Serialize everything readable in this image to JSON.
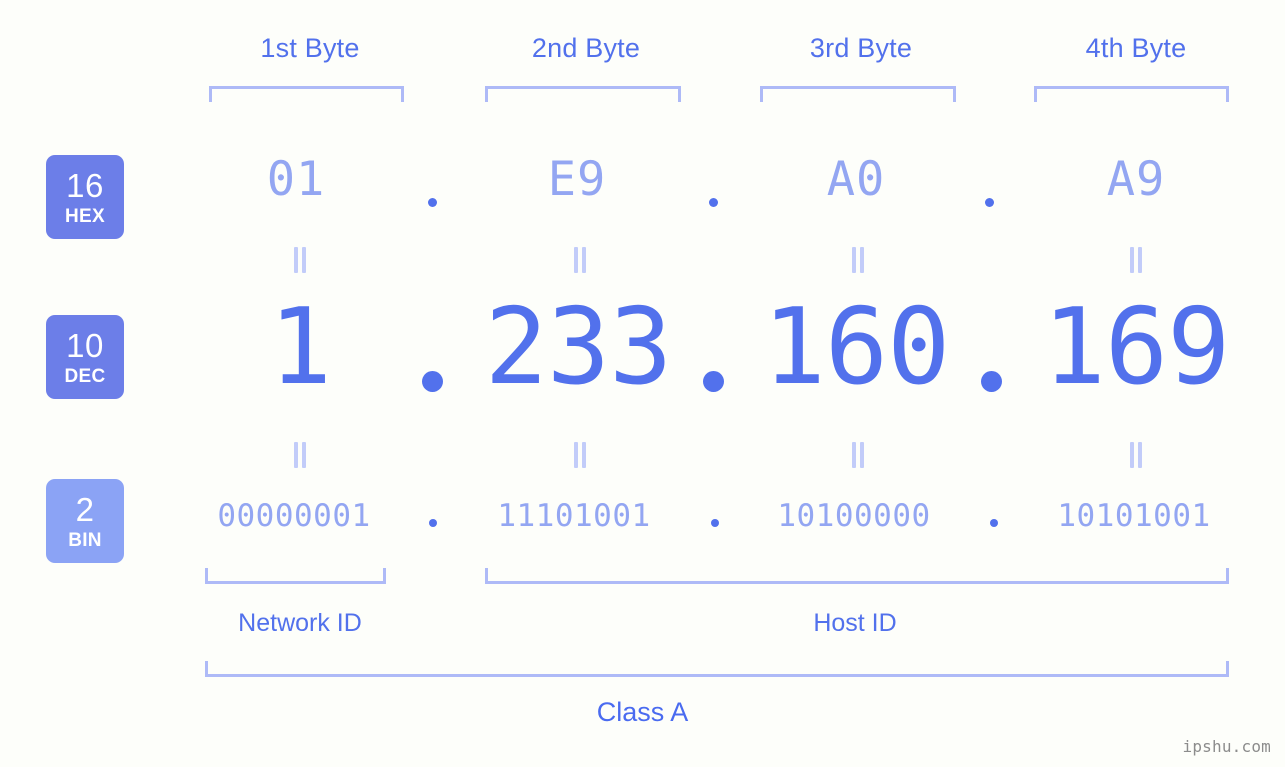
{
  "watermark": "ipshu.com",
  "colors": {
    "background": "#fdfefa",
    "accent_strong": "#5271ec",
    "accent_mid": "#6c7ee8",
    "accent_light": "#93a6f2",
    "bracket": "#aebaf7",
    "equals": "#c2ccf9",
    "badge_bin": "#8ba3f5",
    "class_text": "#4a6bf0",
    "watermark_text": "#8c8c8c"
  },
  "byte_headers": [
    {
      "label": "1st Byte"
    },
    {
      "label": "2nd Byte"
    },
    {
      "label": "3rd Byte"
    },
    {
      "label": "4th Byte"
    }
  ],
  "bases": [
    {
      "num": "16",
      "name": "HEX"
    },
    {
      "num": "10",
      "name": "DEC"
    },
    {
      "num": "2",
      "name": "BIN"
    }
  ],
  "separator": ".",
  "equals_symbol": "=",
  "rows": {
    "hex": {
      "octets": [
        "01",
        "E9",
        "A0",
        "A9"
      ]
    },
    "dec": {
      "octets": [
        "1",
        "233",
        "160",
        "169"
      ]
    },
    "bin": {
      "octets": [
        "00000001",
        "11101001",
        "10100000",
        "10101001"
      ]
    }
  },
  "segments": [
    {
      "label": "Network ID"
    },
    {
      "label": "Host ID"
    }
  ],
  "class": {
    "label": "Class A"
  },
  "chart_data": {
    "type": "diagram",
    "title": "IP address byte breakdown",
    "ip_address": "1.233.160.169",
    "hex_address": "01.E9.A0.A9",
    "binary_address": "00000001.11101001.10100000.10101001",
    "address_class": "Class A",
    "network_id_bytes": [
      1
    ],
    "host_id_bytes": [
      2,
      3,
      4
    ],
    "bytes": [
      {
        "index": 1,
        "header": "1st Byte",
        "hex": "01",
        "dec": "1",
        "bin": "00000001",
        "part": "Network ID"
      },
      {
        "index": 2,
        "header": "2nd Byte",
        "hex": "E9",
        "dec": "233",
        "bin": "11101001",
        "part": "Host ID"
      },
      {
        "index": 3,
        "header": "3rd Byte",
        "hex": "A0",
        "dec": "160",
        "bin": "10100000",
        "part": "Host ID"
      },
      {
        "index": 4,
        "header": "4th Byte",
        "hex": "A9",
        "dec": "169",
        "bin": "10101001",
        "part": "Host ID"
      }
    ]
  }
}
